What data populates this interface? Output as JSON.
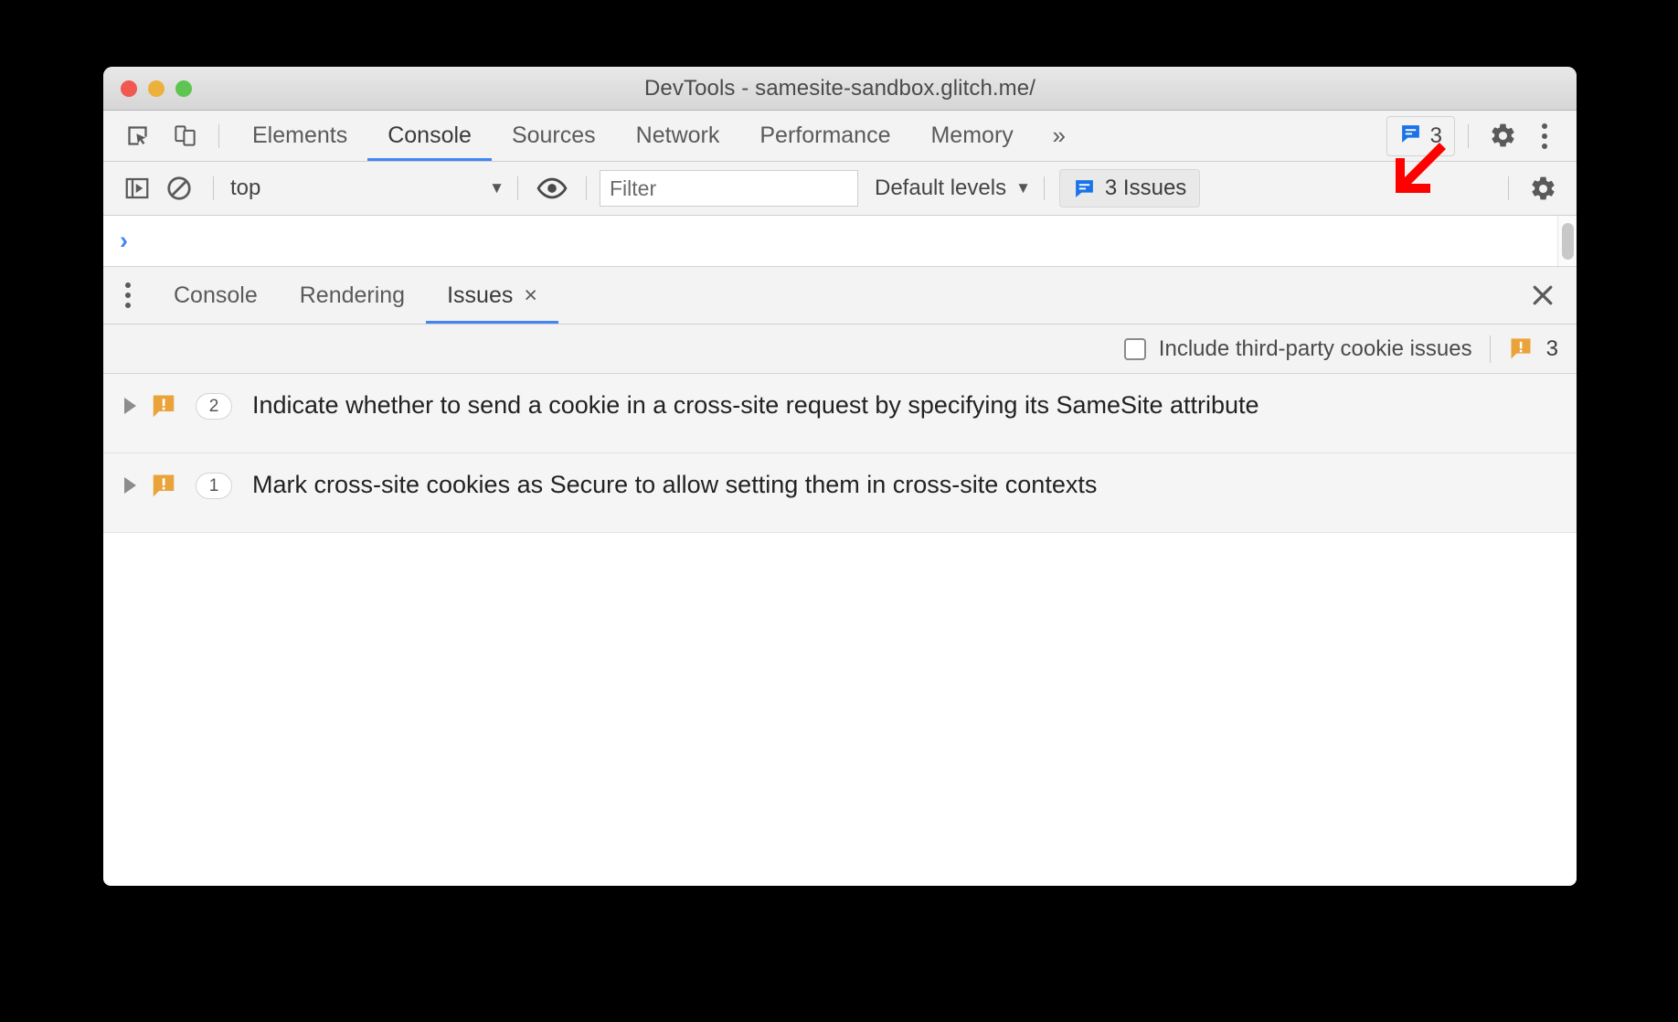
{
  "window": {
    "title": "DevTools - samesite-sandbox.glitch.me/",
    "traffic_lights": [
      "close",
      "minimize",
      "zoom"
    ]
  },
  "tabbar": {
    "inspect_icon": "inspect-element-icon",
    "device_icon": "device-toolbar-icon",
    "tabs": [
      {
        "label": "Elements",
        "active": false
      },
      {
        "label": "Console",
        "active": true
      },
      {
        "label": "Sources",
        "active": false
      },
      {
        "label": "Network",
        "active": false
      },
      {
        "label": "Performance",
        "active": false
      },
      {
        "label": "Memory",
        "active": false
      }
    ],
    "more_tabs_glyph": "»",
    "issues_badge": {
      "icon": "issue-message-icon",
      "count": "3"
    },
    "settings_icon": "gear-icon",
    "more_options_icon": "kebab-menu-icon"
  },
  "console_toolbar": {
    "sidebar_icon": "console-sidebar-icon",
    "clear_icon": "clear-console-icon",
    "context": {
      "value": "top",
      "caret": "▼"
    },
    "eye_icon": "live-expression-icon",
    "filter": {
      "value": "",
      "placeholder": "Filter"
    },
    "levels": {
      "label": "Default levels",
      "caret": "▼"
    },
    "issues_button": {
      "icon": "issue-message-icon",
      "label": "3 Issues"
    },
    "settings_icon": "gear-icon"
  },
  "console_prompt": {
    "caret": "›",
    "value": ""
  },
  "drawer": {
    "menu_icon": "drawer-more-icon",
    "tabs": [
      {
        "label": "Console",
        "active": false,
        "closable": false
      },
      {
        "label": "Rendering",
        "active": false,
        "closable": false
      },
      {
        "label": "Issues",
        "active": true,
        "closable": true,
        "close_glyph": "×"
      }
    ],
    "close_glyph": "✕"
  },
  "issues_toolbar": {
    "third_party_label": "Include third-party cookie issues",
    "third_party_checked": false,
    "summary_icon": "issue-warning-icon",
    "summary_count": "3"
  },
  "issues": [
    {
      "expander": "▶",
      "icon": "issue-warning-icon",
      "count": "2",
      "text": "Indicate whether to send a cookie in a cross-site request by specifying its SameSite attribute"
    },
    {
      "expander": "▶",
      "icon": "issue-warning-icon",
      "count": "1",
      "text": "Mark cross-site cookies as Secure to allow setting them in cross-site contexts"
    }
  ],
  "annotation": {
    "type": "arrow-down-left",
    "color": "#FF0000"
  },
  "colors": {
    "accent_blue": "#4285F4",
    "issue_orange": "#E9A33A",
    "annotation_red": "#FF0000",
    "toolbar_bg": "#F3F3F3",
    "row_bg": "#F5F5F5"
  }
}
